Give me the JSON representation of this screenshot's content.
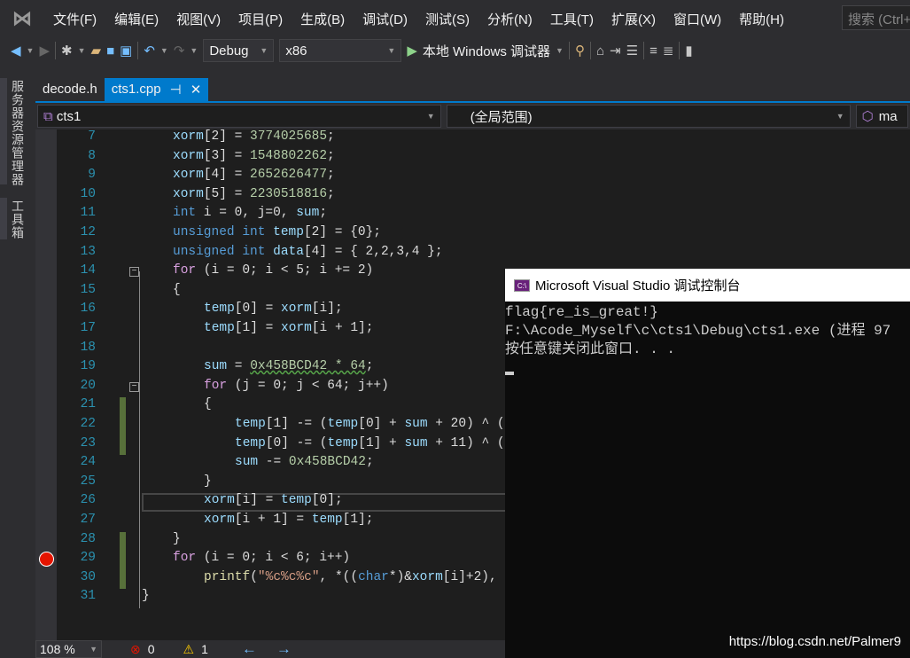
{
  "menu": [
    "文件(F)",
    "编辑(E)",
    "视图(V)",
    "项目(P)",
    "生成(B)",
    "调试(D)",
    "测试(S)",
    "分析(N)",
    "工具(T)",
    "扩展(X)",
    "窗口(W)",
    "帮助(H)"
  ],
  "search_placeholder": "搜索 (Ctrl+",
  "toolbar": {
    "config": "Debug",
    "platform": "x86",
    "run_label": "本地 Windows 调试器"
  },
  "side_tabs": [
    "服务器资源管理器",
    "工具箱"
  ],
  "tabs": [
    {
      "label": "decode.h"
    },
    {
      "label": "cts1.cpp",
      "pin": "⊣",
      "close": "✕"
    }
  ],
  "nav": {
    "project": "cts1",
    "scope": "(全局范围)",
    "member": "ma"
  },
  "code": [
    {
      "n": "7",
      "ind": 1,
      "t": [
        [
          "xorm",
          "var"
        ],
        [
          "[2] = ",
          "pl"
        ],
        [
          "3774025685",
          "num"
        ],
        [
          ";",
          "pl"
        ]
      ]
    },
    {
      "n": "8",
      "ind": 1,
      "t": [
        [
          "xorm",
          "var"
        ],
        [
          "[3] = ",
          "pl"
        ],
        [
          "1548802262",
          "num"
        ],
        [
          ";",
          "pl"
        ]
      ]
    },
    {
      "n": "9",
      "ind": 1,
      "t": [
        [
          "xorm",
          "var"
        ],
        [
          "[4] = ",
          "pl"
        ],
        [
          "2652626477",
          "num"
        ],
        [
          ";",
          "pl"
        ]
      ]
    },
    {
      "n": "10",
      "ind": 1,
      "t": [
        [
          "xorm",
          "var"
        ],
        [
          "[5] = ",
          "pl"
        ],
        [
          "2230518816",
          "num"
        ],
        [
          ";",
          "pl"
        ]
      ]
    },
    {
      "n": "11",
      "ind": 1,
      "t": [
        [
          "int",
          "kw"
        ],
        [
          " i = 0, j=0, ",
          "pl"
        ],
        [
          "sum",
          "var"
        ],
        [
          ";",
          "pl"
        ]
      ]
    },
    {
      "n": "12",
      "ind": 1,
      "t": [
        [
          "unsigned int",
          "kw"
        ],
        [
          " ",
          "pl"
        ],
        [
          "temp",
          "var"
        ],
        [
          "[2] = {0};",
          "pl"
        ]
      ]
    },
    {
      "n": "13",
      "ind": 1,
      "t": [
        [
          "unsigned int",
          "kw"
        ],
        [
          " ",
          "pl"
        ],
        [
          "data",
          "var"
        ],
        [
          "[4] = { 2,2,3,4 };",
          "pl"
        ]
      ]
    },
    {
      "n": "14",
      "ind": 1,
      "t": [
        [
          "for",
          "ctl"
        ],
        [
          " (i = 0; i < 5; i += 2)",
          "pl"
        ]
      ]
    },
    {
      "n": "15",
      "ind": 1,
      "t": [
        [
          "{",
          "pl"
        ]
      ]
    },
    {
      "n": "16",
      "ind": 2,
      "t": [
        [
          "temp",
          "var"
        ],
        [
          "[0] = ",
          "pl"
        ],
        [
          "xorm",
          "var"
        ],
        [
          "[i];",
          "pl"
        ]
      ]
    },
    {
      "n": "17",
      "ind": 2,
      "t": [
        [
          "temp",
          "var"
        ],
        [
          "[1] = ",
          "pl"
        ],
        [
          "xorm",
          "var"
        ],
        [
          "[i + 1];",
          "pl"
        ]
      ]
    },
    {
      "n": "18",
      "ind": 2,
      "t": []
    },
    {
      "n": "19",
      "ind": 2,
      "t": [
        [
          "sum",
          "var"
        ],
        [
          " = ",
          "pl"
        ],
        [
          "0x458BCD42 * 64",
          "num squig"
        ],
        [
          ";",
          "pl"
        ]
      ]
    },
    {
      "n": "20",
      "ind": 2,
      "t": [
        [
          "for",
          "ctl"
        ],
        [
          " (j = 0; j < 64; j++)",
          "pl"
        ]
      ]
    },
    {
      "n": "21",
      "ind": 2,
      "t": [
        [
          "{",
          "pl"
        ]
      ]
    },
    {
      "n": "22",
      "ind": 3,
      "t": [
        [
          "temp",
          "var"
        ],
        [
          "[1] -= (",
          "pl"
        ],
        [
          "temp",
          "var"
        ],
        [
          "[0] + ",
          "pl"
        ],
        [
          "sum",
          "var"
        ],
        [
          " + 20) ^ (",
          "pl"
        ]
      ]
    },
    {
      "n": "23",
      "ind": 3,
      "t": [
        [
          "temp",
          "var"
        ],
        [
          "[0] -= (",
          "pl"
        ],
        [
          "temp",
          "var"
        ],
        [
          "[1] + ",
          "pl"
        ],
        [
          "sum",
          "var"
        ],
        [
          " + 11) ^ (",
          "pl"
        ]
      ]
    },
    {
      "n": "24",
      "ind": 3,
      "t": [
        [
          "sum",
          "var"
        ],
        [
          " -= ",
          "pl"
        ],
        [
          "0x458BCD42",
          "num"
        ],
        [
          ";",
          "pl"
        ]
      ]
    },
    {
      "n": "25",
      "ind": 2,
      "t": [
        [
          "}",
          "pl"
        ]
      ]
    },
    {
      "n": "26",
      "ind": 2,
      "t": [
        [
          "xorm",
          "var"
        ],
        [
          "[i] = ",
          "pl"
        ],
        [
          "temp",
          "var"
        ],
        [
          "[0];",
          "pl"
        ]
      ]
    },
    {
      "n": "27",
      "ind": 2,
      "t": [
        [
          "xorm",
          "var"
        ],
        [
          "[i + 1] = ",
          "pl"
        ],
        [
          "temp",
          "var"
        ],
        [
          "[1];",
          "pl"
        ]
      ]
    },
    {
      "n": "28",
      "ind": 1,
      "t": [
        [
          "}",
          "pl"
        ]
      ]
    },
    {
      "n": "29",
      "ind": 1,
      "t": [
        [
          "for",
          "ctl"
        ],
        [
          " (i = 0; i < 6; i++)",
          "pl"
        ]
      ]
    },
    {
      "n": "30",
      "ind": 2,
      "t": [
        [
          "printf",
          "fn"
        ],
        [
          "(",
          "pl"
        ],
        [
          "\"%c%c%c\"",
          "str"
        ],
        [
          ", *((",
          "pl"
        ],
        [
          "char",
          "kw"
        ],
        [
          "*)&",
          "pl"
        ],
        [
          "xorm",
          "var"
        ],
        [
          "[i]+2),",
          "pl"
        ]
      ]
    },
    {
      "n": "31",
      "ind": 0,
      "t": [
        [
          "}",
          "pl"
        ]
      ]
    }
  ],
  "status": {
    "zoom": "108 %",
    "errors": "0",
    "warnings": "1"
  },
  "console": {
    "title": "Microsoft Visual Studio 调试控制台",
    "icon_text": "C:\\",
    "lines": [
      "flag{re_is_great!}",
      "F:\\Acode_Myself\\c\\cts1\\Debug\\cts1.exe (进程 97",
      "按任意键关闭此窗口. . ."
    ]
  },
  "watermark": "https://blog.csdn.net/Palmer9",
  "colors": {
    "accent": "#007acc",
    "breakpoint": "#e51400",
    "keyword": "#569cd6",
    "control": "#d8a0df",
    "number": "#b5cea8"
  }
}
